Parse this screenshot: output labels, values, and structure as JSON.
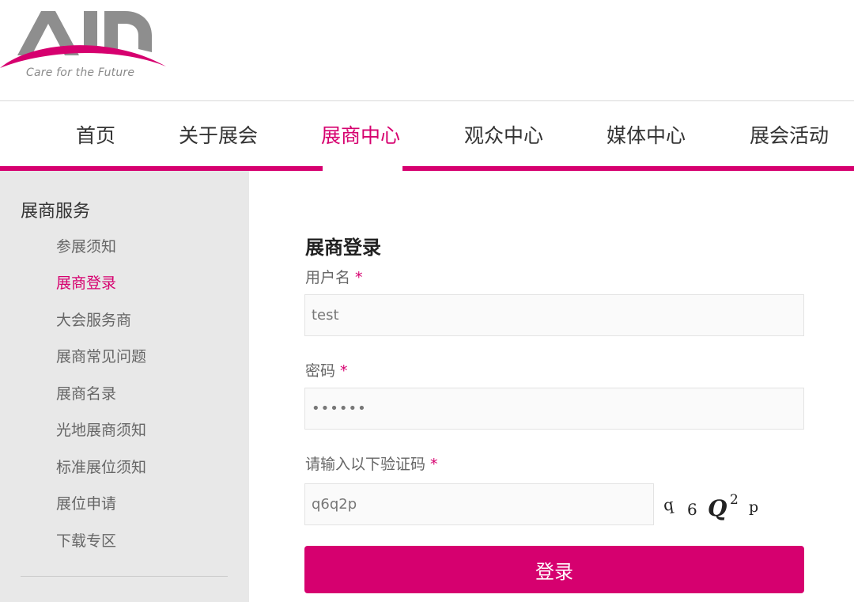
{
  "brand": {
    "logo_text": "AID",
    "tagline": "Care for the Future",
    "accent_color": "#d6006f"
  },
  "nav": {
    "items": [
      {
        "label": "首页"
      },
      {
        "label": "关于展会"
      },
      {
        "label": "展商中心"
      },
      {
        "label": "观众中心"
      },
      {
        "label": "媒体中心"
      },
      {
        "label": "展会活动"
      }
    ],
    "active": "展商中心"
  },
  "sidebar": {
    "title": "展商服务",
    "items": [
      {
        "label": "参展须知"
      },
      {
        "label": "展商登录"
      },
      {
        "label": "大会服务商"
      },
      {
        "label": "展商常见问题"
      },
      {
        "label": "展商名录"
      },
      {
        "label": "光地展商须知"
      },
      {
        "label": "标准展位须知"
      },
      {
        "label": "展位申请"
      },
      {
        "label": "下载专区"
      }
    ],
    "active": "展商登录"
  },
  "form": {
    "title": "展商登录",
    "username": {
      "label": "用户名",
      "required_mark": "*",
      "value": "test"
    },
    "password": {
      "label": "密码",
      "required_mark": "*",
      "value": "••••••"
    },
    "captcha_field": {
      "label": "请输入以下验证码",
      "required_mark": "*",
      "value": "q6q2p"
    },
    "captcha_image_chars": [
      "q",
      "6",
      "Q",
      "2",
      "p"
    ],
    "submit_label": "登录"
  }
}
